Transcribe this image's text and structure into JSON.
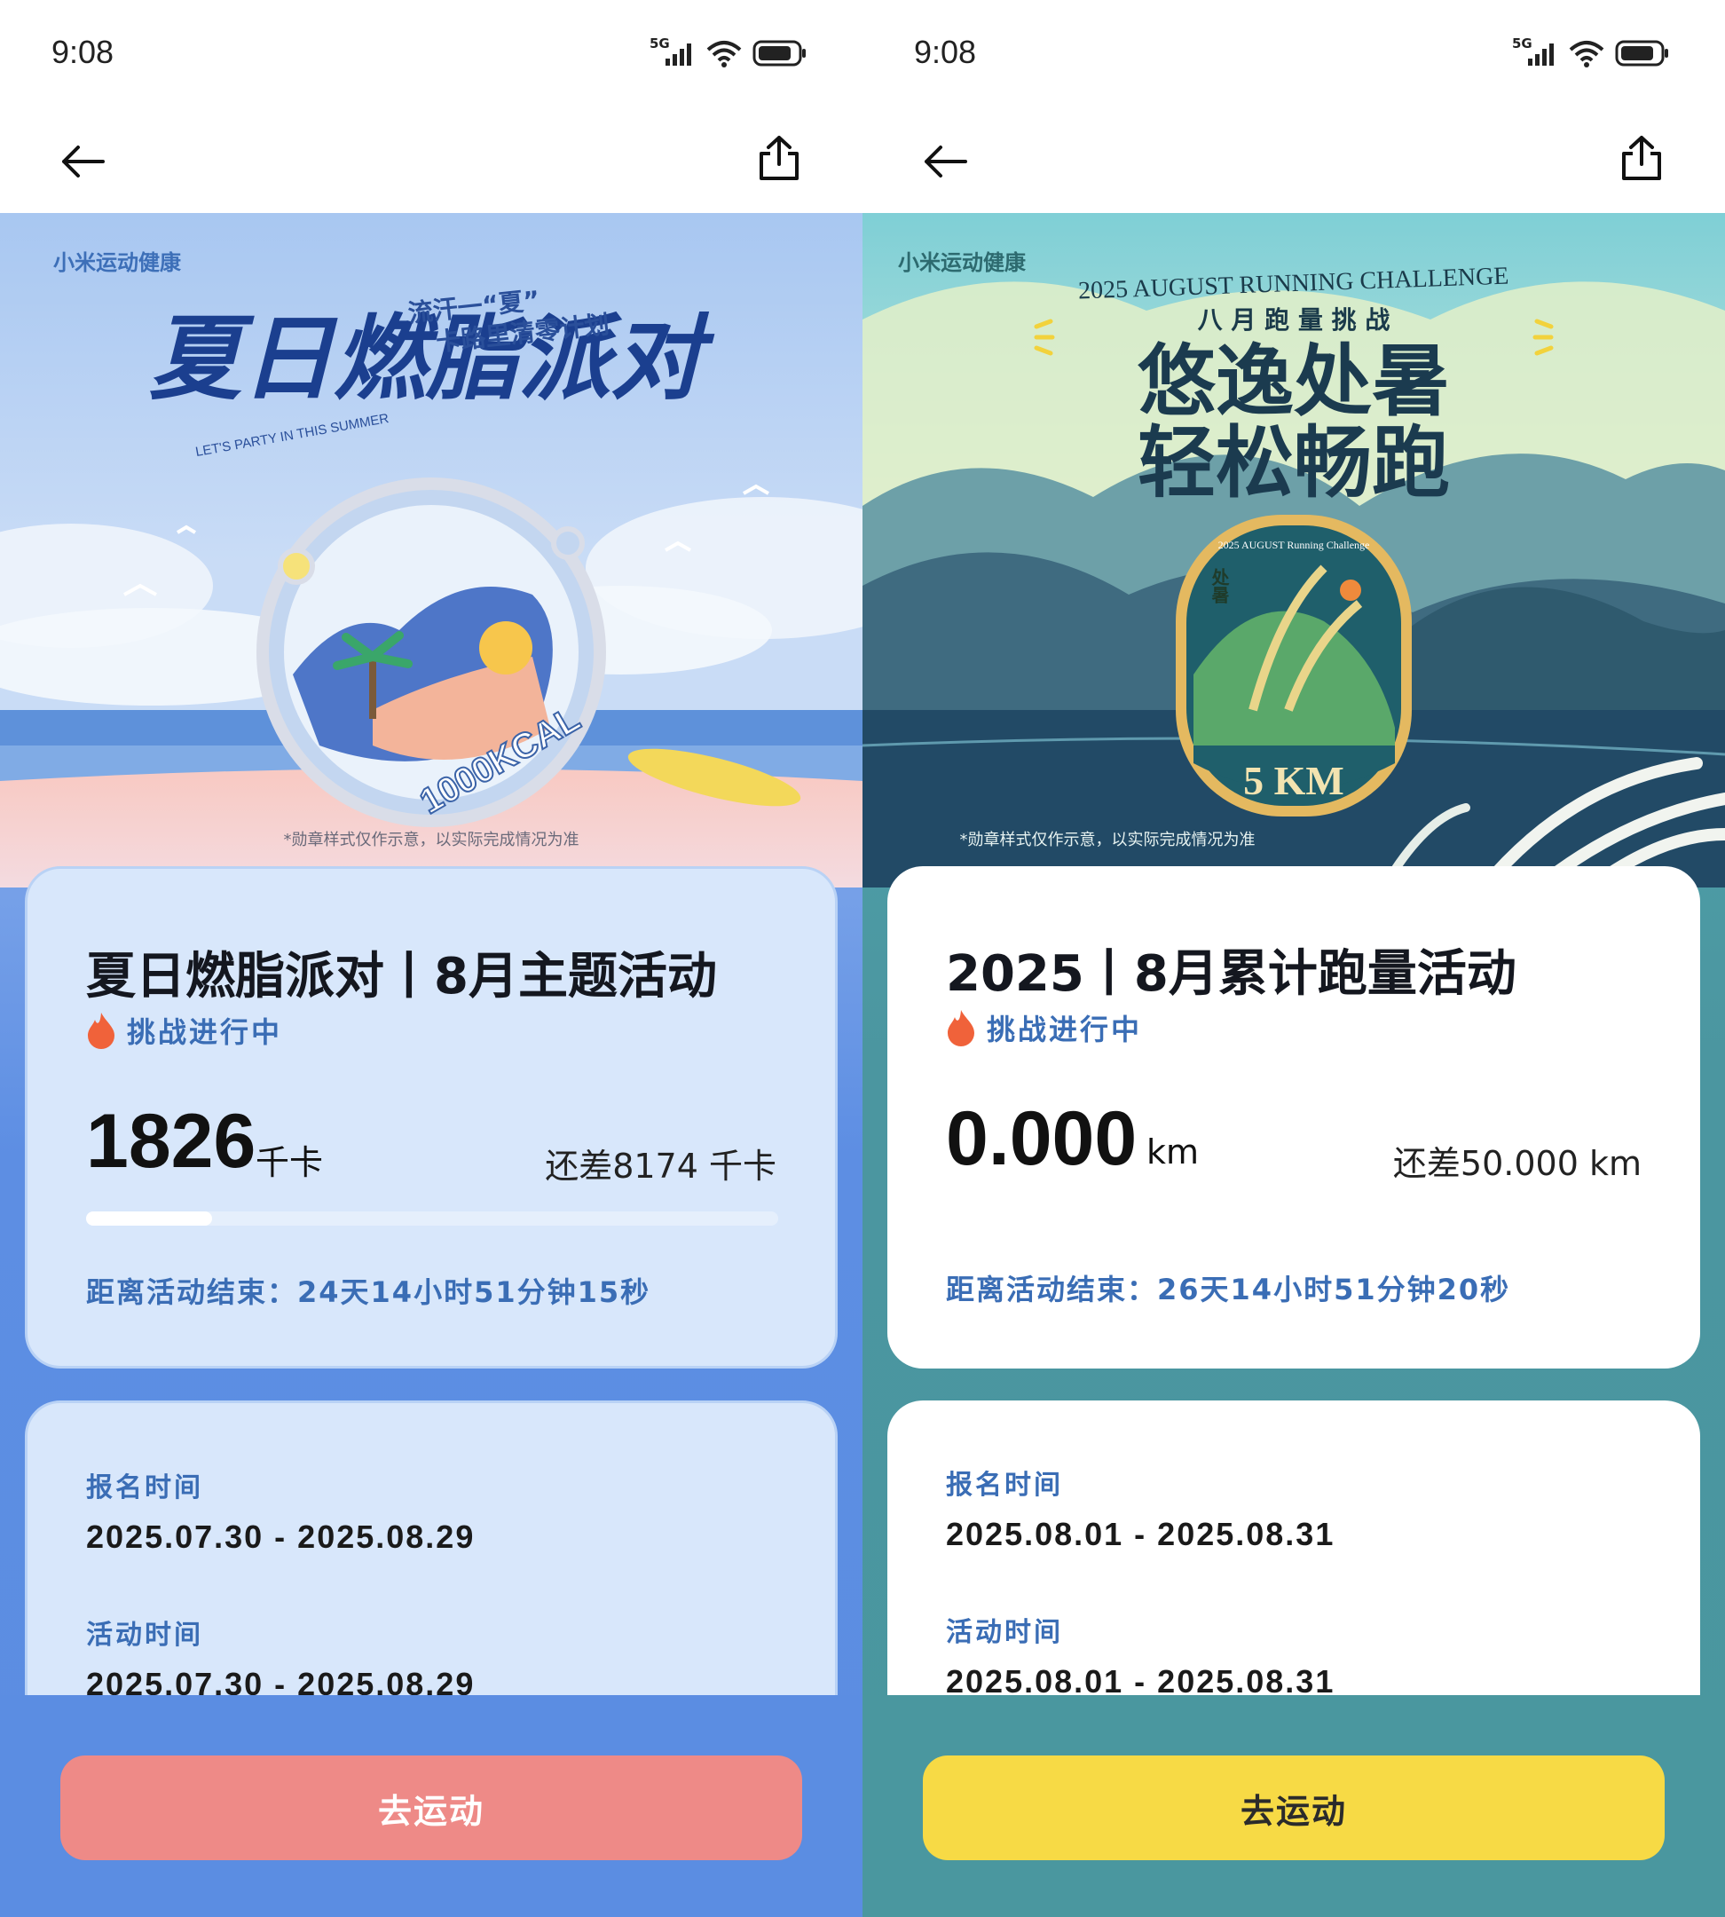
{
  "screens": [
    {
      "status_bar": {
        "time": "9:08",
        "network": "5G"
      },
      "banner": {
        "brand": "小米运动健康",
        "headline": "夏日燃脂派对",
        "slogan_line1": "流汗一“夏”",
        "slogan_line2": "卡路里清零计划",
        "english_tag": "LET'S PARTY IN THIS SUMMER",
        "medal_text": "1000KCAL",
        "disclaimer": "*勋章样式仅作示意，以实际完成情况为准"
      },
      "card": {
        "title": "夏日燃脂派对丨8月主题活动",
        "status": "挑战进行中",
        "value": "1826",
        "unit": "千卡",
        "remaining": "还差8174 千卡",
        "progress_fraction": 0.1826,
        "countdown": "距离活动结束：24天14小时51分钟15秒"
      },
      "info": {
        "signup_label": "报名时间",
        "signup_value": "2025.07.30 - 2025.08.29",
        "activity_label": "活动时间",
        "activity_value": "2025.07.30 - 2025.08.29"
      },
      "button": "去运动"
    },
    {
      "status_bar": {
        "time": "9:08",
        "network": "5G"
      },
      "banner": {
        "brand": "小米运动健康",
        "english_title": "2025 AUGUST RUNNING CHALLENGE",
        "subtitle": "八 月 跑 量 挑 战",
        "headline_line1": "悠逸处暑",
        "headline_line2": "轻松畅跑",
        "medal_top": "2025 AUGUST Running Challenge",
        "medal_side": "处暑",
        "medal_distance": "5 KM",
        "disclaimer": "*勋章样式仅作示意，以实际完成情况为准"
      },
      "card": {
        "title": "2025丨8月累计跑量活动",
        "status": "挑战进行中",
        "value": "0.000",
        "unit": "km",
        "remaining": "还差50.000 km",
        "progress_fraction": 0,
        "countdown": "距离活动结束：26天14小时51分钟20秒"
      },
      "info": {
        "signup_label": "报名时间",
        "signup_value": "2025.08.01 - 2025.08.31",
        "activity_label": "活动时间",
        "activity_value": "2025.08.01 - 2025.08.31"
      },
      "button": "去运动"
    }
  ],
  "colors": {
    "left_background": "#5b8de2",
    "left_button": "#ee8a87",
    "right_background": "#4a979f",
    "right_button": "#f7da45",
    "accent_text": "#3a6db5",
    "flame": "#f0623a"
  }
}
